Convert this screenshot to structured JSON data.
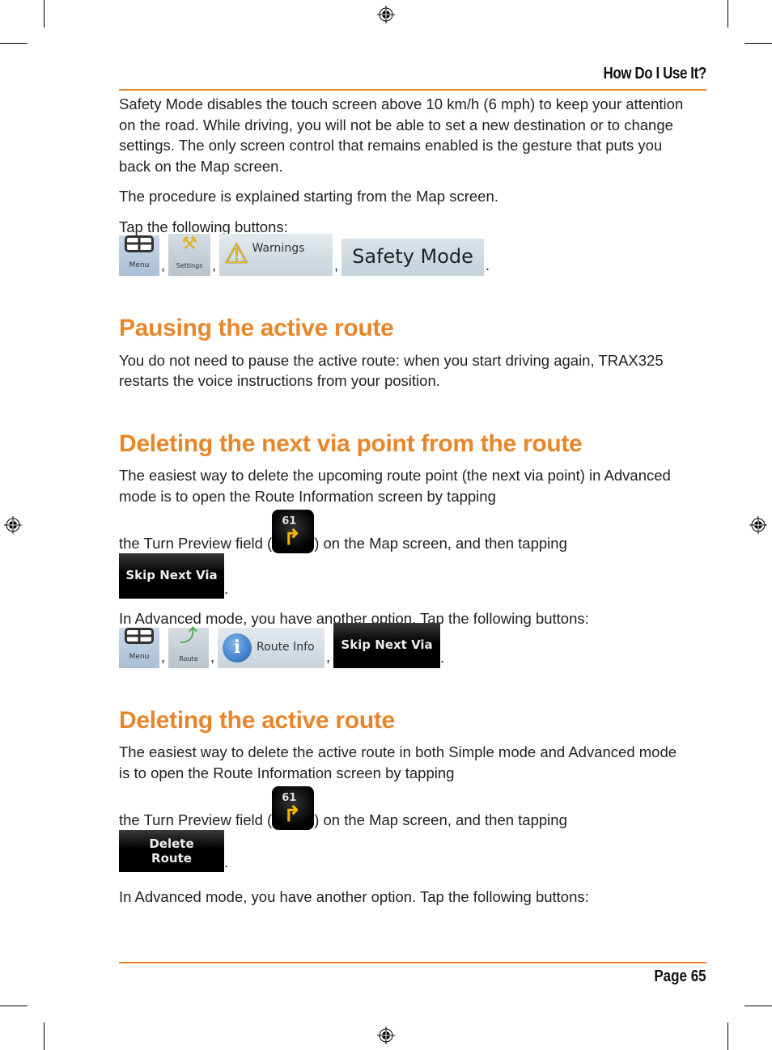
{
  "header": {
    "title": "How Do I Use It?"
  },
  "footer": {
    "page": "Page 65"
  },
  "safety": {
    "para1": "Safety Mode disables the touch screen above 10 km/h (6 mph) to keep your attention on the road. While driving, you will not be able to set a new destination or to change settings. The only screen control that remains enabled is the gesture that puts you back on the Map screen.",
    "para2": "The procedure is explained starting from the Map screen.",
    "para3": "Tap the following buttons:",
    "buttons": {
      "menu": "Menu",
      "settings": "Settings",
      "warnings": "Warnings",
      "safety_mode": "Safety Mode"
    }
  },
  "pausing": {
    "heading": "Pausing the active route",
    "para": "You do not need to pause the active route: when you start driving again, TRAX325 restarts the voice instructions from your position."
  },
  "deleting_via": {
    "heading": "Deleting the next via point from the route",
    "para1a": "The easiest way to delete the upcoming route point (the next via point) in Advanced mode is to open the Route Information screen by tapping",
    "para1b": "the Turn Preview field (",
    "para1c": ") on the Map screen, and then tapping",
    "turn_distance": "61",
    "skip_label": "Skip Next Via",
    "para2": "In Advanced mode, you have another option. Tap the following buttons:",
    "buttons": {
      "menu": "Menu",
      "route": "Route",
      "route_info": "Route Info",
      "skip": "Skip Next Via"
    }
  },
  "deleting_route": {
    "heading": "Deleting the active route",
    "para1a": "The easiest way to delete the active route in both Simple mode and Advanced mode is to open the Route Information screen by tapping",
    "para1b": "the Turn Preview field (",
    "para1c": ") on the Map screen, and then tapping",
    "turn_distance": "61",
    "delete_label_1": "Delete",
    "delete_label_2": "Route",
    "para2": "In Advanced mode, you have another option. Tap the following buttons:"
  },
  "punct": {
    "comma": ",",
    "period": "."
  }
}
